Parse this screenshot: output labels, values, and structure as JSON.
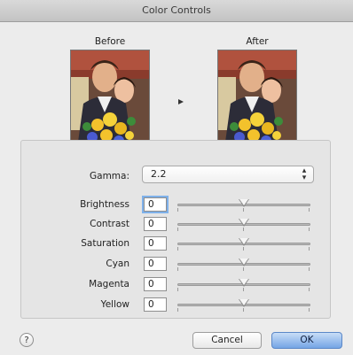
{
  "window": {
    "title": "Color Controls"
  },
  "preview": {
    "before_label": "Before",
    "after_label": "After"
  },
  "gamma": {
    "label": "Gamma:",
    "value": "2.2"
  },
  "adjustments": [
    {
      "label": "Brightness",
      "value": "0",
      "level": 0.5
    },
    {
      "label": "Contrast",
      "value": "0",
      "level": 0.5
    },
    {
      "label": "Saturation",
      "value": "0",
      "level": 0.5
    },
    {
      "label": "Cyan",
      "value": "0",
      "level": 0.5
    },
    {
      "label": "Magenta",
      "value": "0",
      "level": 0.5
    },
    {
      "label": "Yellow",
      "value": "0",
      "level": 0.5
    }
  ],
  "buttons": {
    "help": "?",
    "cancel": "Cancel",
    "ok": "OK"
  }
}
